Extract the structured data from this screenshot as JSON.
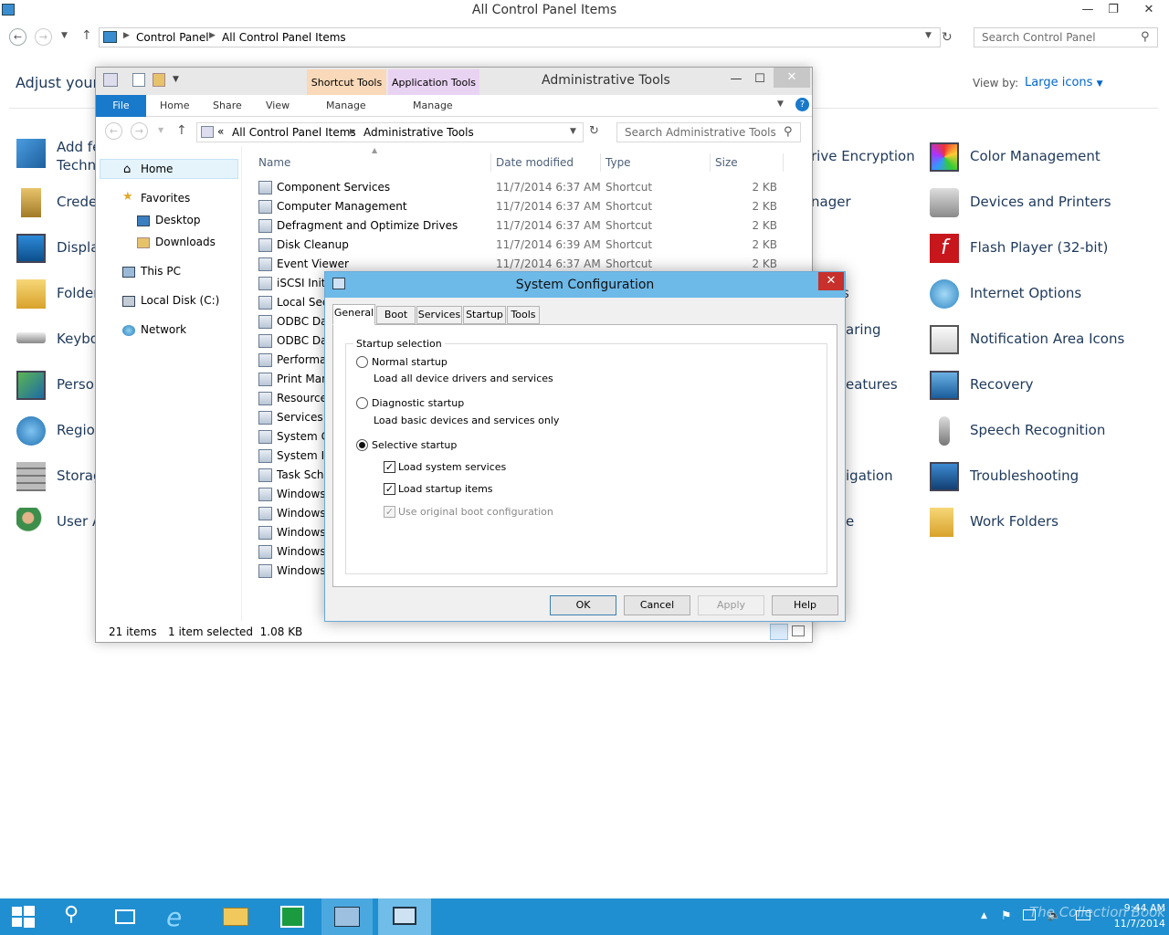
{
  "control_panel": {
    "title": "All Control Panel Items",
    "breadcrumb": [
      "Control Panel",
      "All Control Panel Items"
    ],
    "search_placeholder": "Search Control Panel",
    "heading": "Adjust your c",
    "view_by_label": "View by:",
    "view_by_value": "Large icons",
    "left_items": [
      "Add fe",
      "Techni",
      "Crede",
      "Displa",
      "Folder",
      "Keybo",
      "Person",
      "Region",
      "Storag",
      "User A"
    ],
    "mid_items": [
      "rive Encryption",
      "nager",
      "s",
      "aring",
      "eatures",
      "igation",
      "e"
    ],
    "right_items": [
      "Color Management",
      "Devices and Printers",
      "Flash Player (32-bit)",
      "Internet Options",
      "Notification Area Icons",
      "Recovery",
      "Speech Recognition",
      "Troubleshooting",
      "Work Folders"
    ]
  },
  "admin_tools": {
    "title": "Administrative Tools",
    "context_tabs": [
      "Shortcut Tools",
      "Application Tools"
    ],
    "ribbon_tabs": [
      "File",
      "Home",
      "Share",
      "View",
      "Manage",
      "Manage"
    ],
    "breadcrumb_prefix": "«",
    "breadcrumb": [
      "All Control Panel Items",
      "Administrative Tools"
    ],
    "search_placeholder": "Search Administrative Tools",
    "nav": [
      "Home",
      "Favorites",
      "Desktop",
      "Downloads",
      "This PC",
      "Local Disk (C:)",
      "Network"
    ],
    "columns": [
      "Name",
      "Date modified",
      "Type",
      "Size"
    ],
    "files": [
      {
        "name": "Component Services",
        "date": "11/7/2014 6:37 AM",
        "type": "Shortcut",
        "size": "2 KB"
      },
      {
        "name": "Computer Management",
        "date": "11/7/2014 6:37 AM",
        "type": "Shortcut",
        "size": "2 KB"
      },
      {
        "name": "Defragment and Optimize Drives",
        "date": "11/7/2014 6:37 AM",
        "type": "Shortcut",
        "size": "2 KB"
      },
      {
        "name": "Disk Cleanup",
        "date": "11/7/2014 6:39 AM",
        "type": "Shortcut",
        "size": "2 KB"
      },
      {
        "name": "Event Viewer",
        "date": "11/7/2014 6:37 AM",
        "type": "Shortcut",
        "size": "2 KB"
      },
      {
        "name": "iSCSI Initia",
        "date": "",
        "type": "",
        "size": ""
      },
      {
        "name": "Local Secu",
        "date": "",
        "type": "",
        "size": ""
      },
      {
        "name": "ODBC Dat",
        "date": "",
        "type": "",
        "size": ""
      },
      {
        "name": "ODBC Dat",
        "date": "",
        "type": "",
        "size": ""
      },
      {
        "name": "Performan",
        "date": "",
        "type": "",
        "size": ""
      },
      {
        "name": "Print Man",
        "date": "",
        "type": "",
        "size": ""
      },
      {
        "name": "Resource",
        "date": "",
        "type": "",
        "size": ""
      },
      {
        "name": "Services",
        "date": "",
        "type": "",
        "size": ""
      },
      {
        "name": "System Co",
        "date": "",
        "type": "",
        "size": ""
      },
      {
        "name": "System In",
        "date": "",
        "type": "",
        "size": ""
      },
      {
        "name": "Task Sche",
        "date": "",
        "type": "",
        "size": ""
      },
      {
        "name": "Windows",
        "date": "",
        "type": "",
        "size": ""
      },
      {
        "name": "Windows",
        "date": "",
        "type": "",
        "size": ""
      },
      {
        "name": "Windows",
        "date": "",
        "type": "",
        "size": ""
      },
      {
        "name": "Windows",
        "date": "",
        "type": "",
        "size": ""
      },
      {
        "name": "Windows",
        "date": "",
        "type": "",
        "size": ""
      }
    ],
    "status_count": "21 items",
    "status_selected": "1 item selected  1.08 KB"
  },
  "sysconfig": {
    "title": "System Configuration",
    "tabs": [
      "General",
      "Boot",
      "Services",
      "Startup",
      "Tools"
    ],
    "group_label": "Startup selection",
    "normal": "Normal startup",
    "normal_desc": "Load all device drivers and services",
    "diagnostic": "Diagnostic startup",
    "diagnostic_desc": "Load basic devices and services only",
    "selective": "Selective startup",
    "load_services": "Load system services",
    "load_startup": "Load startup items",
    "use_original": "Use original boot configuration",
    "buttons": {
      "ok": "OK",
      "cancel": "Cancel",
      "apply": "Apply",
      "help": "Help"
    }
  },
  "taskbar": {
    "time": "9:44 AM",
    "date": "11/7/2014",
    "watermark": "The Collection Book"
  },
  "colors": {
    "accent": "#1f8fd1",
    "link": "#1e395b",
    "dialog_title": "#6db9e8",
    "close_red": "#c7302b"
  }
}
